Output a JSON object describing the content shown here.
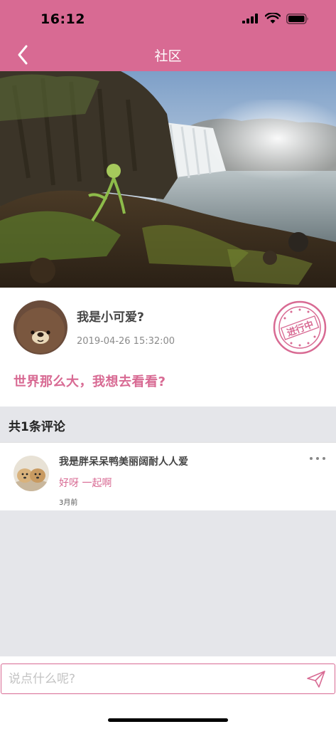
{
  "status_bar": {
    "time": "16:12"
  },
  "nav": {
    "title": "社区",
    "back_icon": "chevron-left-icon"
  },
  "hero": {
    "image": "waterfall-landscape-photo"
  },
  "post": {
    "avatar": "brown-bear-avatar",
    "username": "我是小可爱?",
    "timestamp": "2019-04-26 15:32:00",
    "status_stamp": "进行中",
    "content": "世界那么大，我想去看看?"
  },
  "comments": {
    "count_label": "共1条评论",
    "items": [
      {
        "avatar": "dogs-photo-avatar",
        "username": "我是胖呆呆鸭美丽阔耐人人爱",
        "text": "好呀 一起啊",
        "time": "3月前",
        "more_icon": "more-dots-icon"
      }
    ]
  },
  "composer": {
    "placeholder": "说点什么呢?",
    "send_icon": "paper-plane-icon"
  },
  "colors": {
    "accent": "#d86a93",
    "background": "#e5e6ea"
  }
}
